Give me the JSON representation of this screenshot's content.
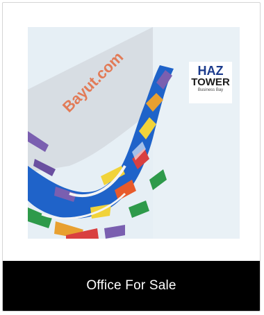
{
  "listing": {
    "caption": "Office For Sale",
    "logo": {
      "line1": "HAZ",
      "line2": "TOWER",
      "line3": "Business Bay"
    },
    "watermark": "Bayut.com"
  },
  "colors": {
    "caption_bg": "#000000",
    "caption_text": "#ffffff",
    "water": "#1f63c9",
    "land": "#e6eff5"
  },
  "icons": [
    "watermark-text"
  ]
}
